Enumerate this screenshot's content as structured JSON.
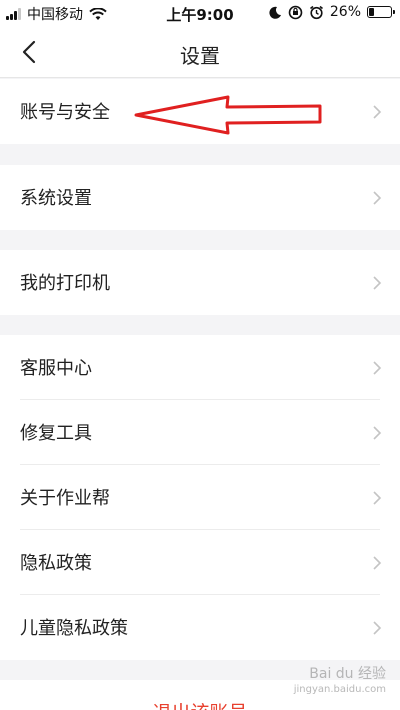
{
  "status_bar": {
    "carrier": "中国移动",
    "time": "上午9:00",
    "battery_percent": "26%",
    "battery_level": 0.26,
    "icons": [
      "signal-icon",
      "wifi-icon",
      "moon-icon",
      "orientation-lock-icon",
      "alarm-icon",
      "battery-icon"
    ]
  },
  "nav": {
    "title": "设置",
    "back_icon": "chevron-left-icon"
  },
  "groups": [
    {
      "items": [
        "账号与安全"
      ]
    },
    {
      "items": [
        "系统设置"
      ]
    },
    {
      "items": [
        "我的打印机"
      ]
    },
    {
      "items": [
        "客服中心",
        "修复工具",
        "关于作业帮",
        "隐私政策",
        "儿童隐私政策"
      ]
    }
  ],
  "logout_label": "退出该账号",
  "annotation": {
    "icon": "red-arrow-icon",
    "color": "#e02020"
  },
  "watermark": {
    "text": "Bai du 经验",
    "subtext": "jingyan.baidu.com"
  },
  "colors": {
    "background": "#f4f4f6",
    "row_background": "#ffffff",
    "logout_text": "#e8412f",
    "chevron": "#c4c4c4"
  }
}
